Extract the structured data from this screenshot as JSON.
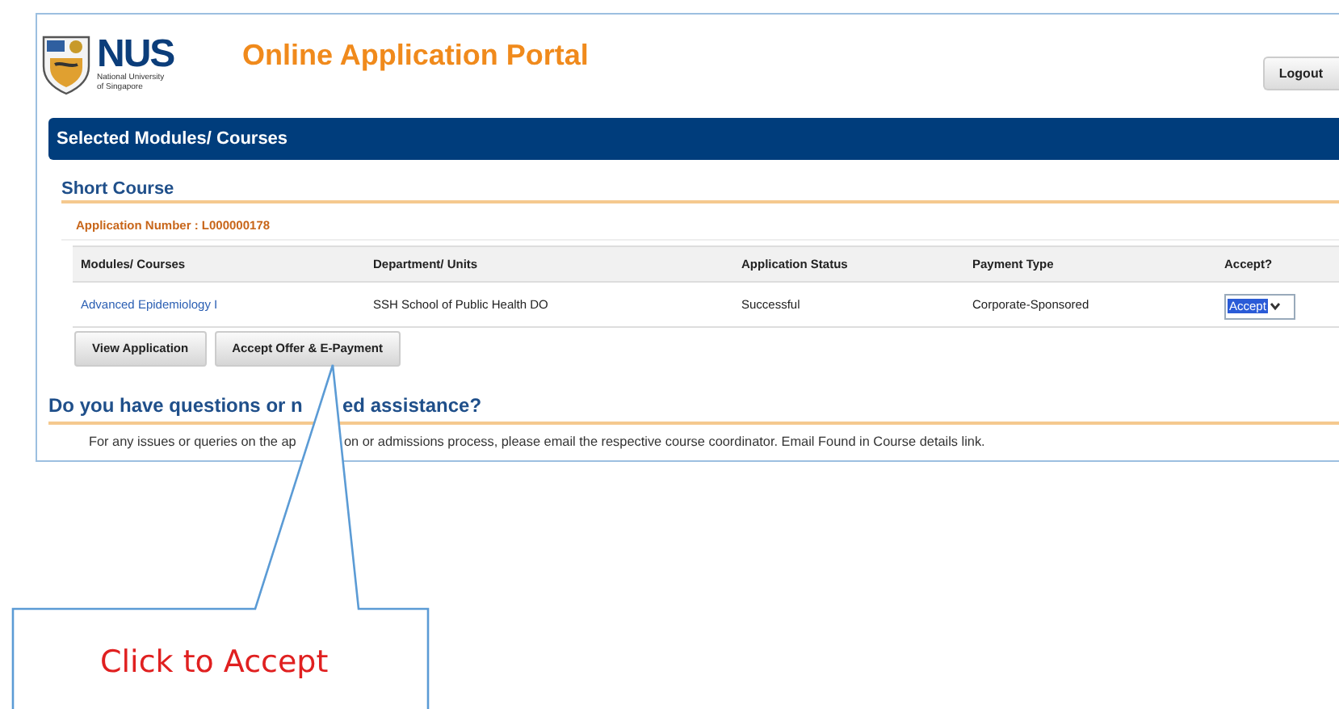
{
  "header": {
    "logo": {
      "wordmark": "NUS",
      "subtitle_lines": [
        "National University",
        "of Singapore"
      ]
    },
    "title": "Online Application Portal",
    "logout": "Logout"
  },
  "section_bar": {
    "title": "Selected Modules/ Courses"
  },
  "short_course": {
    "heading": "Short Course",
    "application_number": "Application Number : L000000178",
    "table": {
      "columns": [
        "Modules/ Courses",
        "Department/ Units",
        "Application Status",
        "Payment Type",
        "Accept?"
      ],
      "rows": [
        {
          "module": "Advanced Epidemiology I",
          "department": "SSH School of Public Health DO",
          "status": "Successful",
          "payment_type": "Corporate-Sponsored",
          "accept": "Accept"
        }
      ]
    },
    "buttons": [
      "View Application",
      "Accept Offer & E-Payment"
    ]
  },
  "help": {
    "heading_parts": [
      "Do you have questions or n",
      "ed assistance?"
    ],
    "text_parts": [
      "For any issues or queries on the ap",
      "on or admissions process, please email the respective course coordinator. Email Found in Course details link."
    ]
  },
  "callout": {
    "text": "Click to Accept"
  }
}
